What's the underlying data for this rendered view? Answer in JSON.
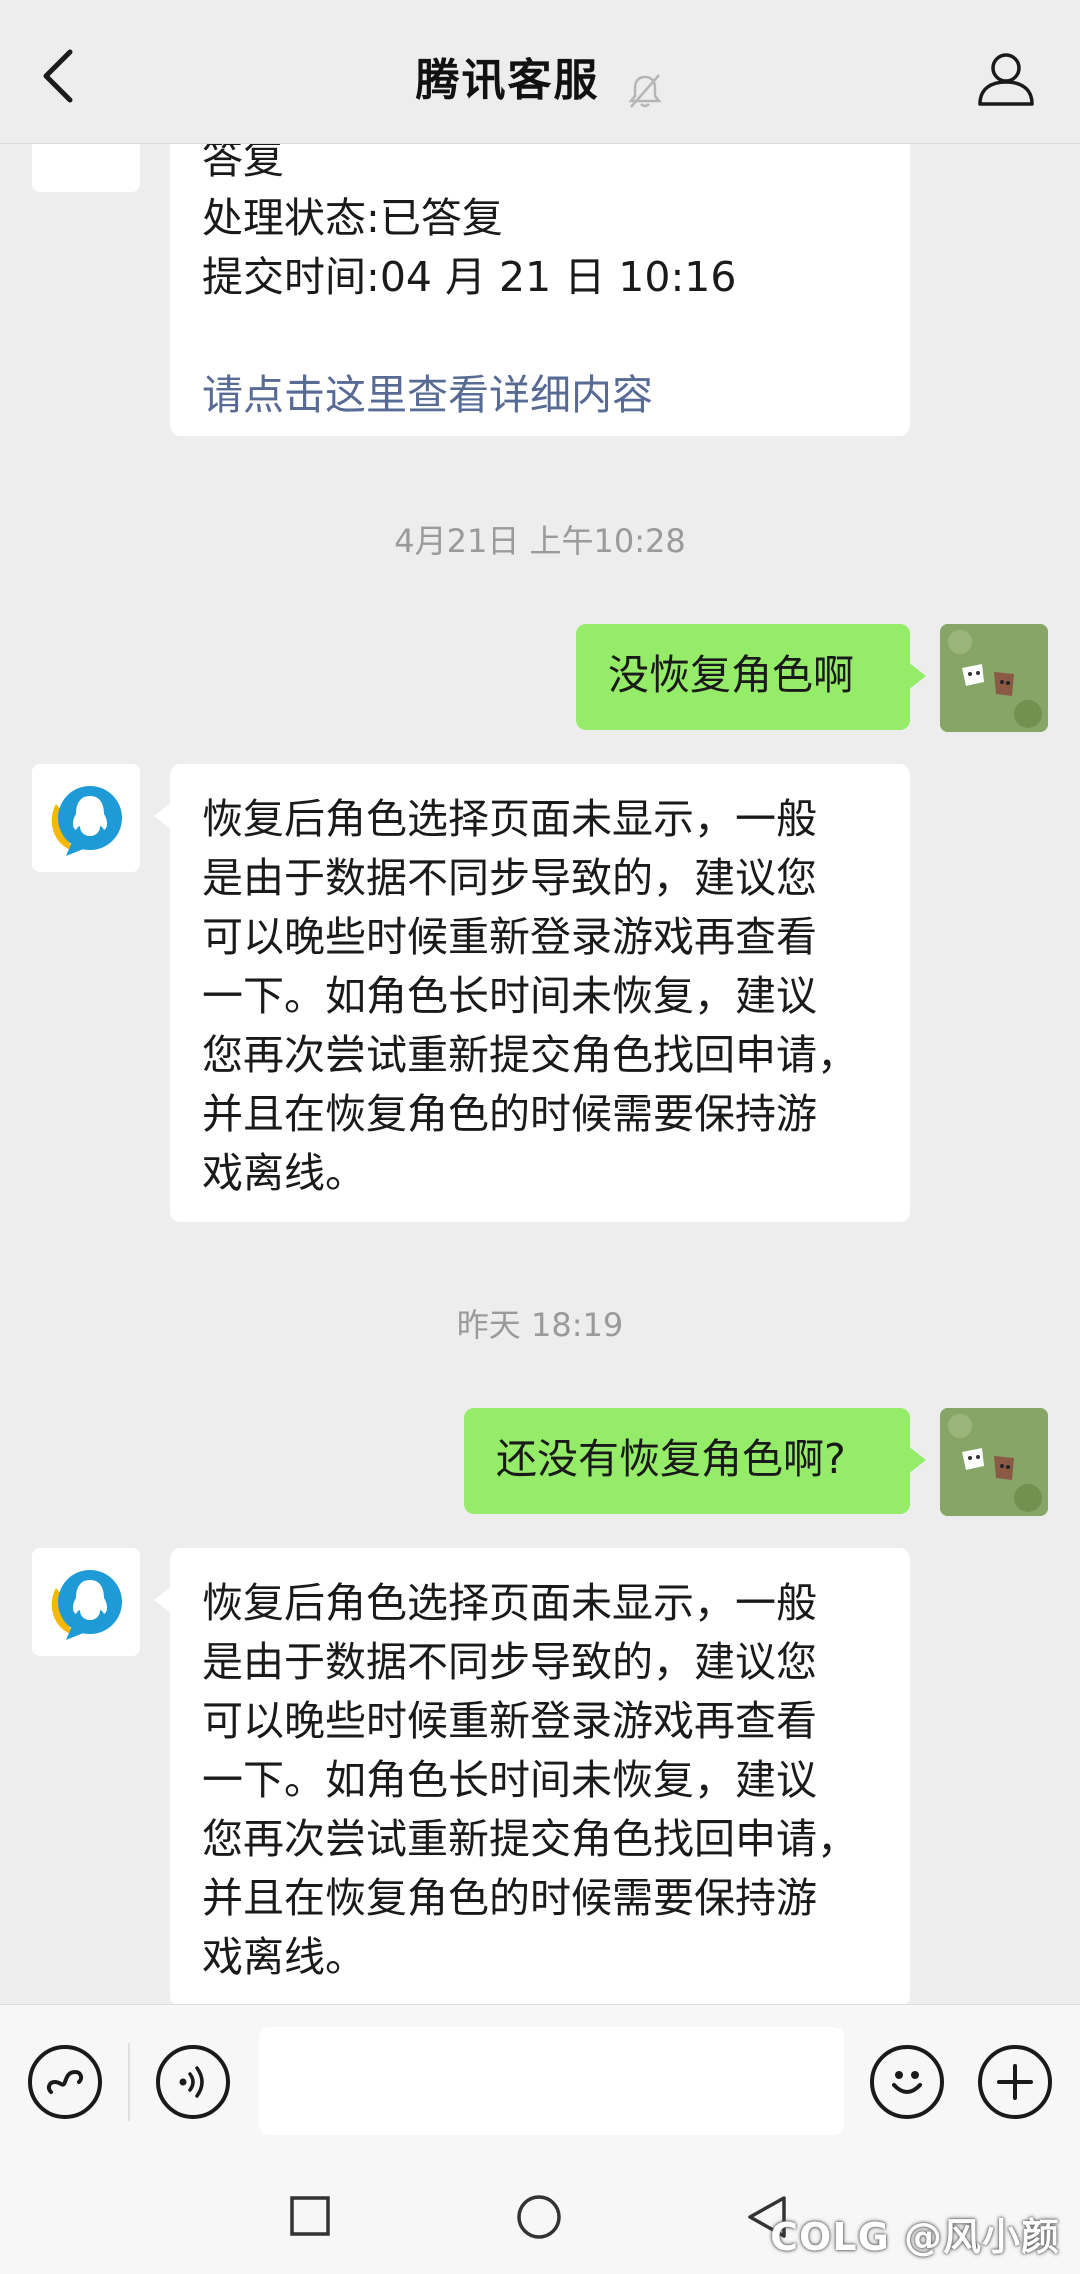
{
  "header": {
    "title": "腾讯客服",
    "back_icon": "chevron-left-icon",
    "mute_icon": "bell-muted-icon",
    "profile_icon": "person-icon"
  },
  "messages": {
    "m1": {
      "sender": "service",
      "lines": [
        "答复",
        "处理状态:已答复",
        "提交时间:04 月 21 日 10:16",
        "",
        "请点击这里查看详细内容"
      ],
      "link_color": "#576b95"
    },
    "t1": "4月21日 上午10:28",
    "m2": {
      "sender": "user",
      "text": "没恢复角色啊"
    },
    "m3": {
      "sender": "service",
      "lines": [
        "恢复后角色选择页面未显示，一般",
        "是由于数据不同步导致的，建议您",
        "可以晚些时候重新登录游戏再查看",
        "一下。如角色长时间未恢复，建议",
        "您再次尝试重新提交角色找回申请，",
        "并且在恢复角色的时候需要保持游",
        "戏离线。"
      ]
    },
    "t2": "昨天 18:19",
    "m4": {
      "sender": "user",
      "text": "还没有恢复角色啊?"
    },
    "m5": {
      "sender": "service",
      "lines": [
        "恢复后角色选择页面未显示，一般",
        "是由于数据不同步导致的，建议您",
        "可以晚些时候重新登录游戏再查看",
        "一下。如角色长时间未恢复，建议",
        "您再次尝试重新提交角色找回申请，",
        "并且在恢复角色的时候需要保持游",
        "戏离线。"
      ]
    }
  },
  "colors": {
    "outgoing_bubble": "#95ec69",
    "incoming_bubble": "#ffffff",
    "background": "#ededed",
    "link": "#576b95"
  },
  "input_bar": {
    "value": "",
    "left_icons": [
      "mini-program-link-icon",
      "voice-icon"
    ],
    "right_icons": [
      "emoji-icon",
      "plus-icon"
    ]
  },
  "system_nav": {
    "buttons": [
      "recent-apps-icon",
      "home-icon",
      "back-triangle-icon"
    ],
    "watermark": "COLG @风小颜"
  }
}
